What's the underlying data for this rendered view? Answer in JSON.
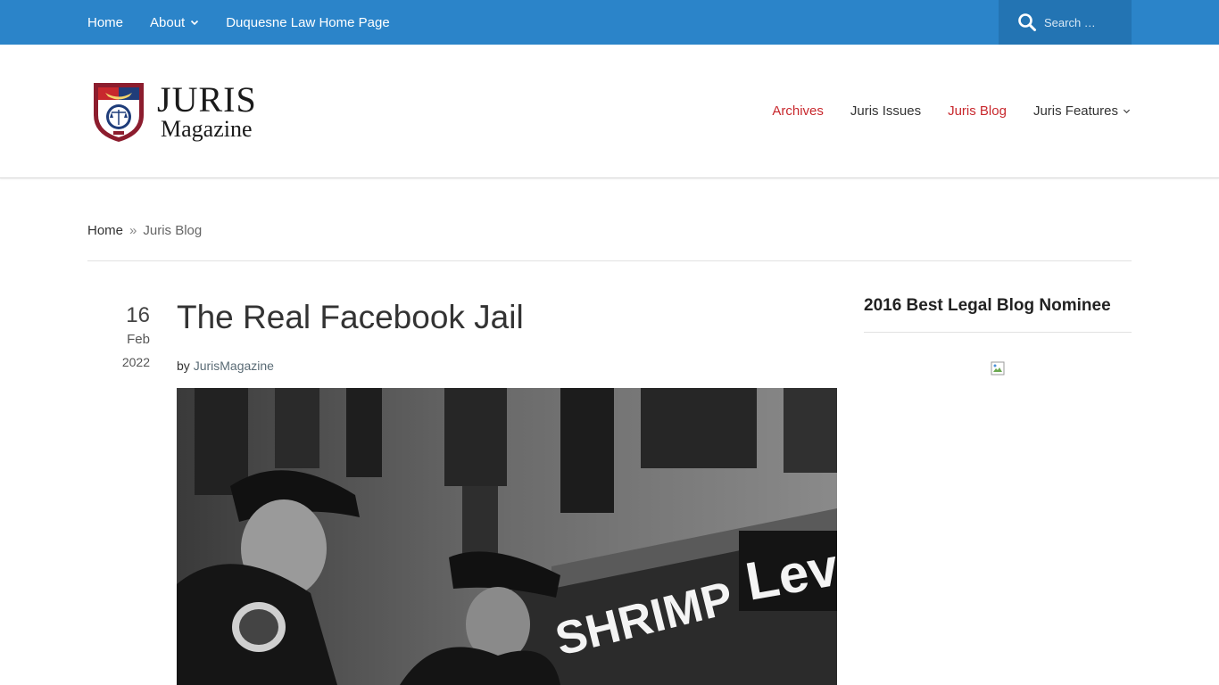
{
  "topbar": {
    "nav": [
      {
        "label": "Home"
      },
      {
        "label": "About"
      },
      {
        "label": "Duquesne Law Home Page"
      }
    ],
    "search_placeholder": "Search …",
    "color": "#2b84c9"
  },
  "header": {
    "logo_title": "JURIS",
    "logo_subtitle": "Magazine",
    "nav": [
      {
        "label": "Archives"
      },
      {
        "label": "Juris Issues"
      },
      {
        "label": "Juris Blog"
      },
      {
        "label": "Juris Features"
      }
    ],
    "accent_color": "#c8282d"
  },
  "breadcrumb": {
    "home": "Home",
    "separator": "»",
    "current": "Juris Blog"
  },
  "post": {
    "date": {
      "day": "16",
      "month": "Feb",
      "year": "2022"
    },
    "title": "The Real Facebook Jail",
    "by_label": "by",
    "author": "JurisMagazine",
    "photo_signs": {
      "shrimp": "SHRIMP CO.",
      "levis": "Lev"
    }
  },
  "sidebar": {
    "widget_title": "2016 Best Legal Blog Nominee"
  }
}
